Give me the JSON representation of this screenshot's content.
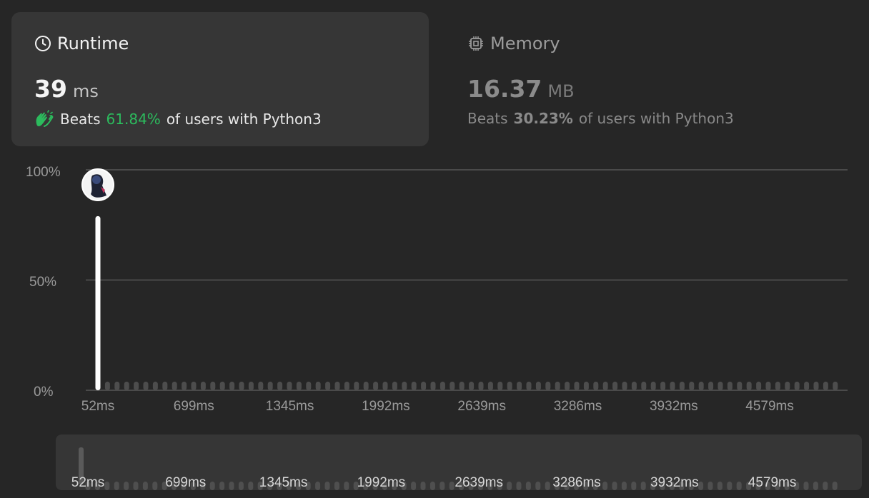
{
  "runtime": {
    "title": "Runtime",
    "value": "39",
    "unit": "ms",
    "beats_prefix": "Beats",
    "beats_pct": "61.84%",
    "beats_suffix": "of users with Python3",
    "icon": "clock-icon",
    "accent": "#2cbb5d"
  },
  "memory": {
    "title": "Memory",
    "value": "16.37",
    "unit": "MB",
    "beats_prefix": "Beats",
    "beats_pct": "30.23%",
    "beats_suffix": "of users with Python3",
    "icon": "cpu-chip-icon"
  },
  "chart_data": {
    "type": "bar",
    "title": "",
    "xlabel": "",
    "ylabel": "",
    "ylim": [
      0,
      100
    ],
    "yticks": [
      "100%",
      "50%",
      "0%"
    ],
    "xticks": [
      "52ms",
      "699ms",
      "1345ms",
      "1992ms",
      "2639ms",
      "3286ms",
      "3932ms",
      "4579ms"
    ],
    "highlight": {
      "x": "52ms",
      "value": 79,
      "marker": "user-avatar"
    },
    "small_bar_count": 78,
    "small_bar_value": 2,
    "grid": true
  },
  "navigator": {
    "ticks": [
      "52ms",
      "699ms",
      "1345ms",
      "1992ms",
      "2639ms",
      "3286ms",
      "3932ms",
      "4579ms"
    ]
  }
}
